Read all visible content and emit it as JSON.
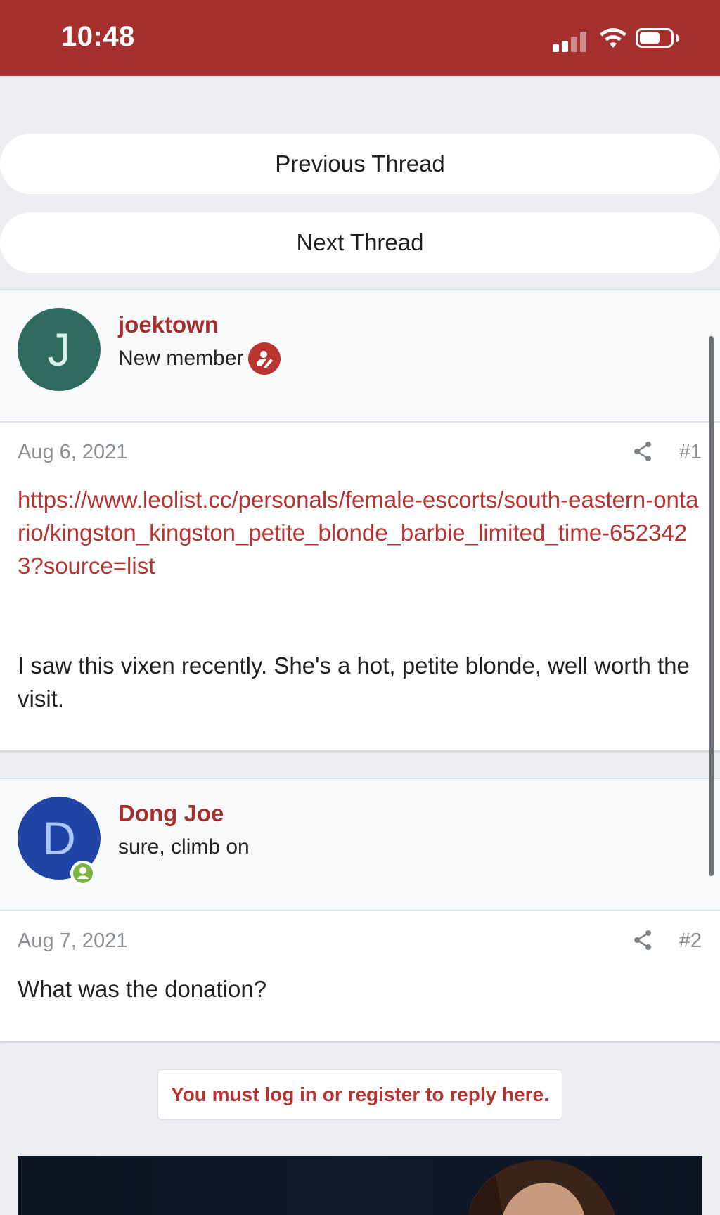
{
  "status_bar": {
    "time": "10:48"
  },
  "nav": {
    "previous_thread": "Previous Thread",
    "next_thread": "Next Thread"
  },
  "posts": [
    {
      "author": "joektown",
      "author_title": "New member",
      "avatar_letter": "J",
      "avatar_color": "#2e6b5e",
      "date": "Aug 6, 2021",
      "number": "#1",
      "link": "https://www.leolist.cc/personals/female-escorts/south-eastern-ontario/kingston_kingston_petite_blonde_barbie_limited_time-6523423?source=list",
      "text": "I saw this vixen recently. She's a hot, petite blonde, well worth the visit."
    },
    {
      "author": "Dong Joe",
      "author_title": "sure, climb on",
      "avatar_letter": "D",
      "avatar_color": "#1f44a5",
      "date": "Aug 7, 2021",
      "number": "#2",
      "text": "What was the donation?"
    }
  ],
  "reply_notice": "You must log in or register to reply here.",
  "colors": {
    "accent": "#a52f2d",
    "link": "#b53431",
    "online": "#7cb342"
  },
  "icons": [
    "signal-icon",
    "wifi-icon",
    "battery-icon",
    "member-badge-icon",
    "online-status-icon",
    "share-icon"
  ]
}
